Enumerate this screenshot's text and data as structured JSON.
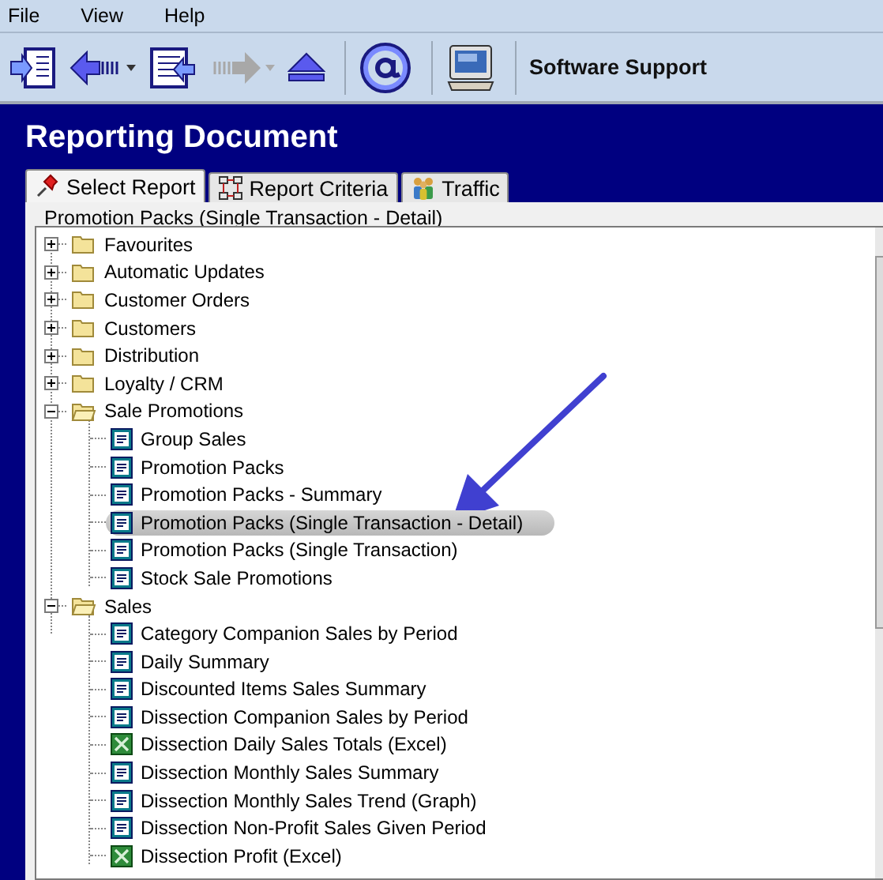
{
  "menu": [
    "File",
    "View",
    "Help"
  ],
  "toolbar": {
    "groups": [
      [
        {
          "kind": "panel-in",
          "disabled": false,
          "dropdown": false
        },
        {
          "kind": "back",
          "disabled": false,
          "dropdown": true
        },
        {
          "kind": "report-in",
          "disabled": false,
          "dropdown": false
        },
        {
          "kind": "forward",
          "disabled": true,
          "dropdown": true
        },
        {
          "kind": "eject",
          "disabled": false,
          "dropdown": false
        }
      ],
      [
        {
          "kind": "at",
          "disabled": false,
          "dropdown": false
        }
      ],
      [
        {
          "kind": "computer",
          "disabled": false,
          "dropdown": false
        }
      ]
    ],
    "label": "Software Support"
  },
  "title": "Reporting Document",
  "tabs": [
    {
      "label": "Select Report",
      "kind": "pin",
      "selected": true
    },
    {
      "label": "Report Criteria",
      "kind": "criteria",
      "selected": false
    },
    {
      "label": "Traffic",
      "kind": "people",
      "selected": false
    }
  ],
  "group_label": "Promotion Packs (Single Transaction - Detail)",
  "tree": [
    {
      "label": "Favourites",
      "kind": "folder",
      "expanded": false
    },
    {
      "label": "Automatic Updates",
      "kind": "folder",
      "expanded": false
    },
    {
      "label": "Customer Orders",
      "kind": "folder",
      "expanded": false
    },
    {
      "label": "Customers",
      "kind": "folder",
      "expanded": false
    },
    {
      "label": "Distribution",
      "kind": "folder",
      "expanded": false
    },
    {
      "label": "Loyalty / CRM",
      "kind": "folder",
      "expanded": false
    },
    {
      "label": "Sale Promotions",
      "kind": "folder",
      "expanded": true,
      "children": [
        {
          "label": "Group Sales",
          "kind": "report",
          "selected": false
        },
        {
          "label": "Promotion Packs",
          "kind": "report",
          "selected": false
        },
        {
          "label": "Promotion Packs - Summary",
          "kind": "report",
          "selected": false
        },
        {
          "label": "Promotion Packs (Single Transaction - Detail)",
          "kind": "report",
          "selected": true
        },
        {
          "label": "Promotion Packs (Single Transaction)",
          "kind": "report",
          "selected": false
        },
        {
          "label": "Stock Sale Promotions",
          "kind": "report",
          "selected": false
        }
      ]
    },
    {
      "label": "Sales",
      "kind": "folder",
      "expanded": true,
      "children": [
        {
          "label": "Category Companion Sales by Period",
          "kind": "report",
          "selected": false
        },
        {
          "label": "Daily Summary",
          "kind": "report",
          "selected": false
        },
        {
          "label": "Discounted Items Sales Summary",
          "kind": "report",
          "selected": false
        },
        {
          "label": "Dissection Companion Sales by Period",
          "kind": "report",
          "selected": false
        },
        {
          "label": "Dissection Daily Sales Totals (Excel)",
          "kind": "excel",
          "selected": false
        },
        {
          "label": "Dissection Monthly Sales Summary",
          "kind": "report",
          "selected": false
        },
        {
          "label": "Dissection Monthly Sales Trend (Graph)",
          "kind": "report",
          "selected": false
        },
        {
          "label": "Dissection Non-Profit Sales Given Period",
          "kind": "report",
          "selected": false
        },
        {
          "label": "Dissection Profit (Excel)",
          "kind": "excel",
          "selected": false
        }
      ]
    }
  ]
}
